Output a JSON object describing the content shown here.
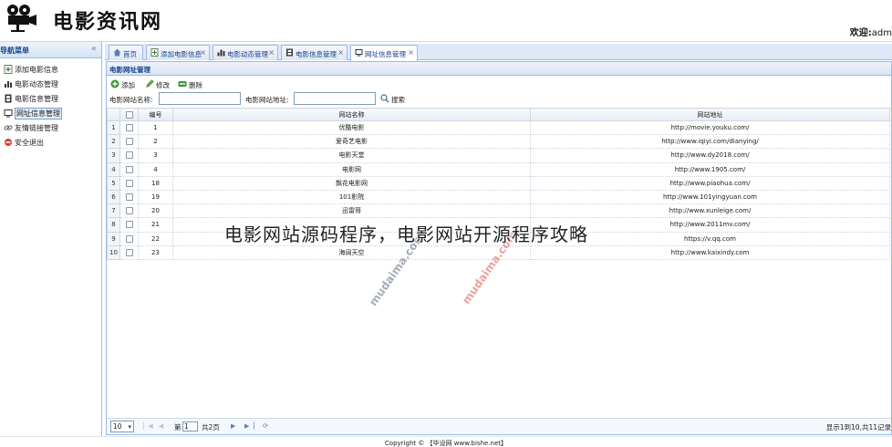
{
  "header": {
    "logo_text": "电影资讯网",
    "welcome_label": "欢迎:",
    "welcome_user": "adm"
  },
  "sidebar": {
    "title": "导航菜单",
    "collapse_glyph": "«",
    "items": [
      {
        "label": "添加电影信息",
        "icon": "add-doc-icon"
      },
      {
        "label": "电影动态管理",
        "icon": "bar-chart-icon"
      },
      {
        "label": "电影信息管理",
        "icon": "film-icon"
      },
      {
        "label": "网址信息管理",
        "icon": "monitor-icon"
      },
      {
        "label": "友情链接管理",
        "icon": "link-icon"
      },
      {
        "label": "安全退出",
        "icon": "exit-icon"
      }
    ]
  },
  "tabs": [
    {
      "label": "首页",
      "icon": "home-icon",
      "closable": false
    },
    {
      "label": "添加电影信息",
      "icon": "add-doc-icon",
      "closable": true
    },
    {
      "label": "电影动态管理",
      "icon": "bar-chart-icon",
      "closable": true
    },
    {
      "label": "电影信息管理",
      "icon": "film-icon",
      "closable": true
    },
    {
      "label": "网址信息管理",
      "icon": "monitor-icon",
      "closable": true
    }
  ],
  "panel": {
    "title": "电影网址管理",
    "toolbar": {
      "add": "添加",
      "edit": "修改",
      "delete": "删除"
    },
    "search": {
      "name_label": "电影网站名称:",
      "url_label": "电影网站地址:",
      "name_value": "",
      "url_value": "",
      "button": "搜索"
    },
    "columns": {
      "id": "编号",
      "name": "网站名称",
      "url": "网站地址"
    },
    "rows": [
      {
        "n": "1",
        "id": "1",
        "name": "优酷电影",
        "url": "http://movie.youku.com/"
      },
      {
        "n": "2",
        "id": "2",
        "name": "爱奇艺电影",
        "url": "http://www.iqiyi.com/dianying/"
      },
      {
        "n": "3",
        "id": "3",
        "name": "电影天堂",
        "url": "http://www.dy2018.com/"
      },
      {
        "n": "4",
        "id": "4",
        "name": "电影网",
        "url": "http://www.1905.com/"
      },
      {
        "n": "5",
        "id": "18",
        "name": "飘花电影网",
        "url": "http://www.piaohua.com/"
      },
      {
        "n": "6",
        "id": "19",
        "name": "101影院",
        "url": "http://www.101yingyuan.com"
      },
      {
        "n": "7",
        "id": "20",
        "name": "迅雷哥",
        "url": "http://www.xunleige.com/"
      },
      {
        "n": "8",
        "id": "21",
        "name": "",
        "url": "http://www.2011mv.com/"
      },
      {
        "n": "9",
        "id": "22",
        "name": "",
        "url": "https://v.qq.com"
      },
      {
        "n": "10",
        "id": "23",
        "name": "海阔天空",
        "url": "http://www.kaixindy.com"
      }
    ],
    "pager": {
      "page_size": "10",
      "page_prefix": "第",
      "page_value": "1",
      "page_suffix": "共2页",
      "info": "显示1到10,共11记录"
    }
  },
  "footer": {
    "text": "Copyright © 【毕设网 www.bishe.net】"
  },
  "watermark": {
    "text": "mudaima.com"
  },
  "overlay": {
    "caption": "电影网站源码程序，电影网站开源程序攻略"
  },
  "colors": {
    "accent": "#15428b",
    "border": "#99bbe8",
    "watermark_a": "#5a6a80",
    "watermark_b": "#d9534f"
  }
}
